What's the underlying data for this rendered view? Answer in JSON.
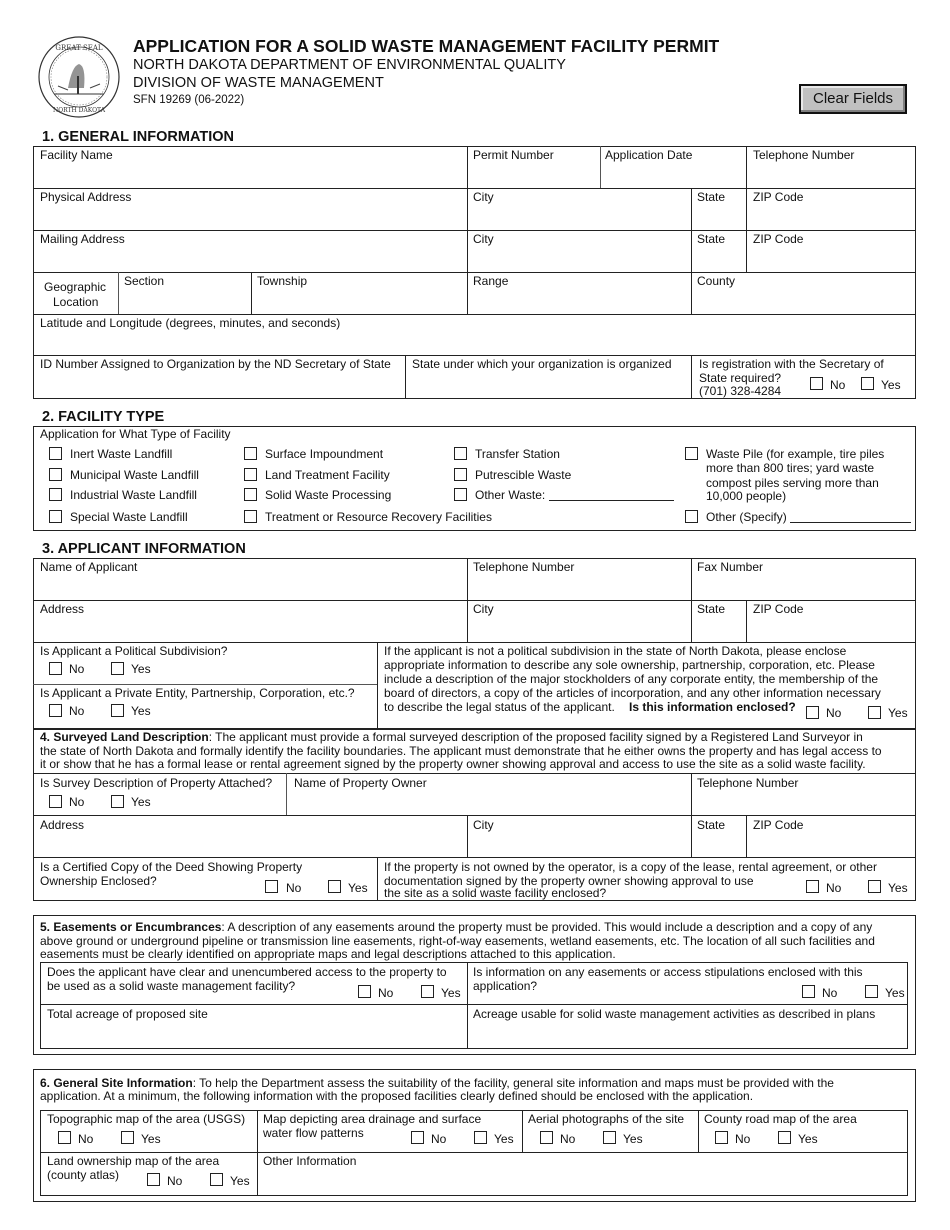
{
  "header": {
    "title": "APPLICATION FOR A SOLID WASTE MANAGEMENT FACILITY PERMIT",
    "department": "NORTH DAKOTA DEPARTMENT OF ENVIRONMENTAL QUALITY",
    "division": "DIVISION OF WASTE MANAGEMENT",
    "form_number": "SFN 19269 (06-2022)",
    "clear_button": "Clear Fields",
    "seal_icon": "north-dakota-great-seal"
  },
  "section1": {
    "title": "1. GENERAL INFORMATION",
    "facility_name": "Facility Name",
    "permit_number": "Permit Number",
    "application_date": "Application Date",
    "telephone": "Telephone Number",
    "physical_address": "Physical Address",
    "city": "City",
    "state": "State",
    "zip": "ZIP Code",
    "mailing_address": "Mailing Address",
    "geo_location_1": "Geographic",
    "geo_location_2": "Location",
    "section": "Section",
    "township": "Township",
    "range": "Range",
    "county": "County",
    "lat_long": "Latitude and Longitude (degrees, minutes, and seconds)",
    "id_number": "ID Number Assigned to Organization by the ND Secretary of State",
    "state_organized": "State under which your organization is organized",
    "registration_q1": "Is registration with the Secretary of",
    "registration_q2": "State required?",
    "registration_phone": "(701) 328-4284",
    "no": "No",
    "yes": "Yes"
  },
  "section2": {
    "title": "2. FACILITY TYPE",
    "subtitle": "Application for What Type of Facility",
    "col1": [
      "Inert Waste Landfill",
      "Municipal Waste Landfill",
      "Industrial Waste Landfill",
      "Special Waste Landfill"
    ],
    "col2": [
      "Surface Impoundment",
      "Land Treatment Facility",
      "Solid Waste Processing",
      "Treatment or Resource Recovery Facilities"
    ],
    "col3": [
      "Transfer Station",
      "Putrescible Waste",
      "Other Waste:"
    ],
    "waste_pile": [
      "Waste Pile (for example, tire piles",
      "more than 800 tires; yard waste",
      "compost piles serving more than",
      "10,000 people)"
    ],
    "other_specify": "Other (Specify)"
  },
  "section3": {
    "title": "3. APPLICANT INFORMATION",
    "name": "Name of Applicant",
    "telephone": "Telephone Number",
    "fax": "Fax Number",
    "address": "Address",
    "city": "City",
    "state": "State",
    "zip": "ZIP Code",
    "political_q": "Is Applicant a Political Subdivision?",
    "private_q": "Is Applicant a Private Entity, Partnership, Corporation, etc.?",
    "info_lines": [
      "If the applicant is not a political subdivision in the state of North Dakota, please enclose",
      "appropriate information to describe any sole ownership, partnership, corporation, etc.  Please",
      "include a description of the major stockholders of any corporate entity, the membership of the",
      "board of directors, a copy of the articles of incorporation, and any other information necessary",
      "to describe the legal status of the applicant."
    ],
    "info_enclosed_q": "Is this information enclosed?",
    "no": "No",
    "yes": "Yes"
  },
  "section4": {
    "title_bold": "4.  Surveyed Land Description",
    "lines": [
      ":  The applicant must provide a formal surveyed description of the proposed facility signed by a Registered Land Surveyor in",
      "the state of North Dakota and formally identify the facility boundaries. The applicant must demonstrate that he either owns the property and has legal access to",
      "it or show that he has a formal lease or rental agreement signed by the property owner showing approval and access to use the site as a solid waste facility."
    ],
    "survey_q": "Is Survey Description of Property Attached?",
    "owner_name": "Name of Property Owner",
    "telephone": "Telephone Number",
    "address": "Address",
    "city": "City",
    "state": "State",
    "zip": "ZIP Code",
    "deed_q1": "Is a Certified Copy of the Deed Showing Property",
    "deed_q2": "Ownership Enclosed?",
    "lease_q": [
      "If the property is not owned by the operator, is a copy of the lease, rental agreement, or other",
      "documentation signed by the property owner showing approval to use",
      "the site as a solid waste facility enclosed?"
    ],
    "no": "No",
    "yes": "Yes"
  },
  "section5": {
    "title_bold": "5. Easements or Encumbrances",
    "lines": [
      ": A description of any easements around the property must be provided. This would include a description and a copy of any",
      "above ground or underground pipeline or transmission line easements, right-of-way easements, wetland easements, etc. The location of all such facilities and",
      "easements must be clearly identified on appropriate maps and legal descriptions attached to this application."
    ],
    "access_q1": "Does the applicant have clear and unencumbered access to the property to",
    "access_q2": "be used as a solid waste management facility?",
    "easement_q1": "Is information on any easements or access stipulations enclosed with this",
    "easement_q2": "application?",
    "total_acreage": "Total acreage of proposed site",
    "usable_acreage": "Acreage usable for solid waste management activities as described in plans",
    "no": "No",
    "yes": "Yes"
  },
  "section6": {
    "title_bold": "6. General Site Information",
    "lines": [
      ": To help the Department assess the suitability of the facility, general site information and maps must be provided with the",
      "application.  At a minimum, the following information with the proposed facilities clearly defined should be enclosed with the application."
    ],
    "topo": "Topographic map of the area (USGS)",
    "drainage1": "Map depicting area drainage and surface",
    "drainage2": "water flow patterns",
    "aerial": "Aerial photographs of the site",
    "county_road": "County road map of the area",
    "land_own1": "Land ownership map of the area",
    "land_own2": "(county atlas)",
    "other_info": "Other Information",
    "no": "No",
    "yes": "Yes"
  }
}
